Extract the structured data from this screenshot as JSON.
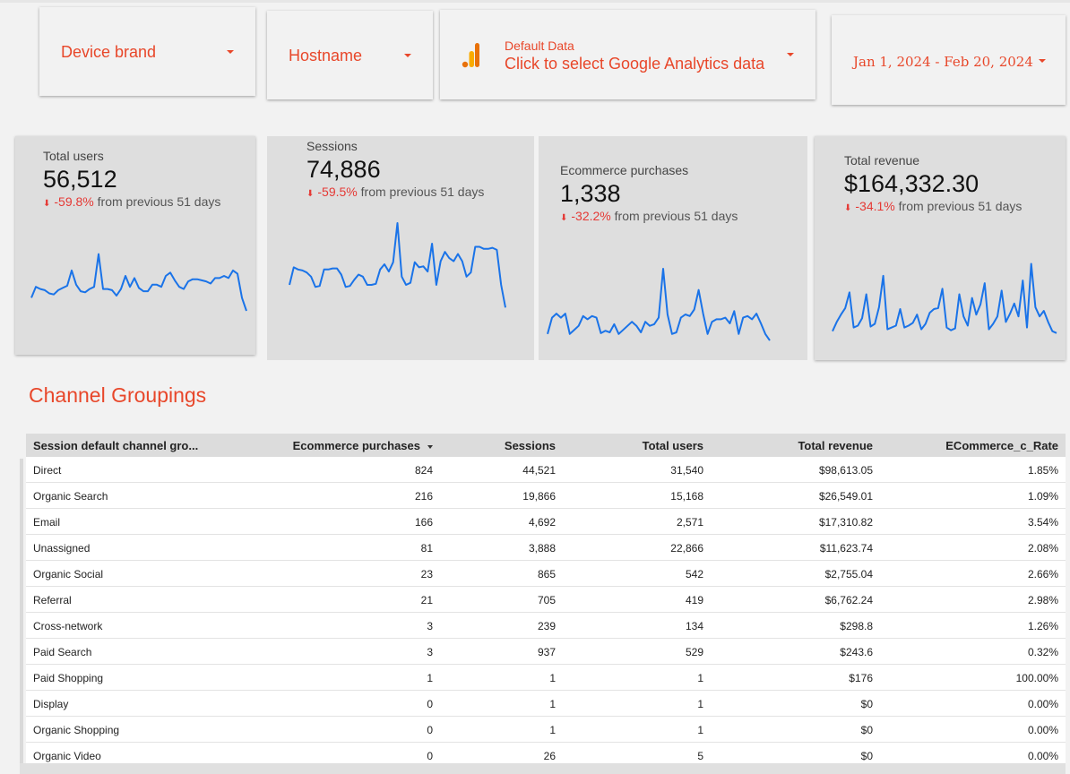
{
  "filters": {
    "device_brand": "Device brand",
    "hostname": "Hostname",
    "data_source_sub": "Default Data",
    "data_source_main": "Click to select Google Analytics data",
    "date_range": "Jan 1, 2024 - Feb 20, 2024"
  },
  "scorecards": [
    {
      "title": "Total users",
      "value": "56,512",
      "delta": "-59.8%",
      "delta_text": "from previous 51 days",
      "trend": [
        0.3,
        0.4,
        0.38,
        0.37,
        0.34,
        0.33,
        0.37,
        0.39,
        0.41,
        0.55,
        0.42,
        0.36,
        0.35,
        0.38,
        0.4,
        0.7,
        0.38,
        0.38,
        0.37,
        0.32,
        0.38,
        0.5,
        0.4,
        0.48,
        0.39,
        0.36,
        0.36,
        0.42,
        0.42,
        0.4,
        0.5,
        0.53,
        0.46,
        0.4,
        0.38,
        0.45,
        0.47,
        0.47,
        0.46,
        0.45,
        0.43,
        0.48,
        0.48,
        0.5,
        0.48,
        0.55,
        0.52,
        0.3,
        0.18
      ]
    },
    {
      "title": "Sessions",
      "value": "74,886",
      "delta": "-59.5%",
      "delta_text": "from previous 51 days",
      "trend": [
        0.4,
        0.57,
        0.55,
        0.54,
        0.52,
        0.48,
        0.38,
        0.39,
        0.55,
        0.55,
        0.56,
        0.56,
        0.5,
        0.38,
        0.39,
        0.45,
        0.5,
        0.48,
        0.4,
        0.4,
        0.41,
        0.55,
        0.6,
        0.53,
        0.62,
        1.0,
        0.48,
        0.4,
        0.42,
        0.62,
        0.57,
        0.58,
        0.53,
        0.8,
        0.4,
        0.63,
        0.72,
        0.66,
        0.63,
        0.7,
        0.63,
        0.48,
        0.52,
        0.77,
        0.77,
        0.75,
        0.75,
        0.76,
        0.74,
        0.4,
        0.18
      ]
    },
    {
      "title": "Ecommerce purchases",
      "value": "1,338",
      "delta": "-32.2%",
      "delta_text": "from previous 51 days",
      "trend": [
        0.2,
        0.4,
        0.45,
        0.4,
        0.45,
        0.2,
        0.25,
        0.3,
        0.42,
        0.38,
        0.42,
        0.4,
        0.21,
        0.24,
        0.22,
        0.32,
        0.2,
        0.25,
        0.3,
        0.35,
        0.3,
        0.22,
        0.35,
        0.3,
        0.32,
        0.4,
        1.0,
        0.44,
        0.2,
        0.22,
        0.4,
        0.44,
        0.42,
        0.5,
        0.74,
        0.45,
        0.2,
        0.35,
        0.38,
        0.38,
        0.4,
        0.33,
        0.48,
        0.2,
        0.4,
        0.42,
        0.38,
        0.45,
        0.33,
        0.2,
        0.12
      ]
    },
    {
      "title": "Total revenue",
      "value": "$164,332.30",
      "delta": "-34.1%",
      "delta_text": "from previous 51 days",
      "trend": [
        0.1,
        0.2,
        0.28,
        0.35,
        0.52,
        0.14,
        0.16,
        0.24,
        0.5,
        0.15,
        0.18,
        0.36,
        0.7,
        0.12,
        0.14,
        0.16,
        0.34,
        0.14,
        0.16,
        0.19,
        0.28,
        0.12,
        0.18,
        0.3,
        0.34,
        0.35,
        0.56,
        0.14,
        0.11,
        0.13,
        0.5,
        0.26,
        0.16,
        0.46,
        0.28,
        0.39,
        0.62,
        0.12,
        0.18,
        0.26,
        0.54,
        0.2,
        0.29,
        0.4,
        0.26,
        0.65,
        0.14,
        0.83,
        0.36,
        0.26,
        0.32,
        0.2,
        0.1,
        0.08
      ]
    }
  ],
  "section_title": "Channel Groupings",
  "table": {
    "headers": [
      "Session default channel gro...",
      "Ecommerce purchases",
      "Sessions",
      "Total users",
      "Total revenue",
      "ECommerce_c_Rate"
    ],
    "rows": [
      [
        "Direct",
        "824",
        "44,521",
        "31,540",
        "$98,613.05",
        "1.85%"
      ],
      [
        "Organic Search",
        "216",
        "19,866",
        "15,168",
        "$26,549.01",
        "1.09%"
      ],
      [
        "Email",
        "166",
        "4,692",
        "2,571",
        "$17,310.82",
        "3.54%"
      ],
      [
        "Unassigned",
        "81",
        "3,888",
        "22,866",
        "$11,623.74",
        "2.08%"
      ],
      [
        "Organic Social",
        "23",
        "865",
        "542",
        "$2,755.04",
        "2.66%"
      ],
      [
        "Referral",
        "21",
        "705",
        "419",
        "$6,762.24",
        "2.98%"
      ],
      [
        "Cross-network",
        "3",
        "239",
        "134",
        "$298.8",
        "1.26%"
      ],
      [
        "Paid Search",
        "3",
        "937",
        "529",
        "$243.6",
        "0.32%"
      ],
      [
        "Paid Shopping",
        "1",
        "1",
        "1",
        "$176",
        "100.00%"
      ],
      [
        "Display",
        "0",
        "1",
        "1",
        "$0",
        "0.00%"
      ],
      [
        "Organic Shopping",
        "0",
        "1",
        "1",
        "$0",
        "0.00%"
      ],
      [
        "Organic Video",
        "0",
        "26",
        "5",
        "$0",
        "0.00%"
      ]
    ],
    "sort_icon": "sort-descending-icon"
  },
  "colors": {
    "accent": "#e8472a",
    "line": "#1a73e8",
    "negative": "#e53935"
  }
}
